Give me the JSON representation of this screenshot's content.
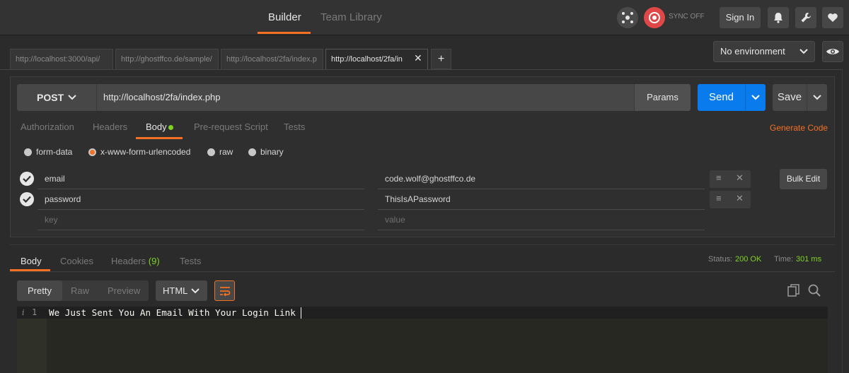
{
  "header": {
    "tabs": [
      {
        "label": "Builder",
        "active": true
      },
      {
        "label": "Team Library",
        "active": false
      }
    ],
    "sync_label": "SYNC OFF",
    "sign_in_label": "Sign In",
    "icons": [
      "interceptor-icon",
      "sync-icon",
      "bell-icon",
      "wrench-icon",
      "heart-icon"
    ]
  },
  "request_tabs": [
    {
      "label": "http://localhost:3000/api/",
      "active": false
    },
    {
      "label": "http://ghostffco.de/sample/",
      "active": false
    },
    {
      "label": "http://localhost/2fa/index.p",
      "active": false
    },
    {
      "label": "http://localhost/2fa/in",
      "active": true
    }
  ],
  "environment": {
    "selected": "No environment"
  },
  "request": {
    "method": "POST",
    "url": "http://localhost/2fa/index.php",
    "params_label": "Params",
    "send_label": "Send",
    "save_label": "Save"
  },
  "request_subtabs": [
    {
      "label": "Authorization",
      "active": false
    },
    {
      "label": "Headers",
      "active": false
    },
    {
      "label": "Body",
      "active": true
    },
    {
      "label": "Pre-request Script",
      "active": false
    },
    {
      "label": "Tests",
      "active": false
    }
  ],
  "generate_code_label": "Generate Code",
  "body_modes": [
    {
      "label": "form-data",
      "selected": false
    },
    {
      "label": "x-www-form-urlencoded",
      "selected": true
    },
    {
      "label": "raw",
      "selected": false
    },
    {
      "label": "binary",
      "selected": false
    }
  ],
  "body_rows": [
    {
      "key": "email",
      "value": "code.wolf@ghostffco.de",
      "checked": true
    },
    {
      "key": "password",
      "value": "ThisIsAPassword",
      "checked": true
    }
  ],
  "new_row": {
    "key_placeholder": "key",
    "value_placeholder": "value"
  },
  "bulk_edit_label": "Bulk Edit",
  "response": {
    "tabs": [
      {
        "label": "Body",
        "active": true
      },
      {
        "label": "Cookies",
        "active": false
      },
      {
        "label": "Headers",
        "active": false,
        "count": "(9)"
      },
      {
        "label": "Tests",
        "active": false
      }
    ],
    "status_label": "Status:",
    "status_value": "200 OK",
    "time_label": "Time:",
    "time_value": "301 ms",
    "view_modes": [
      "Pretty",
      "Raw",
      "Preview"
    ],
    "format": "HTML",
    "line_number": "1",
    "body_text": "We Just Sent You An Email With Your Login Link"
  },
  "colors": {
    "accent": "#f47023",
    "send": "#097bed",
    "status_ok": "#7ed321"
  }
}
